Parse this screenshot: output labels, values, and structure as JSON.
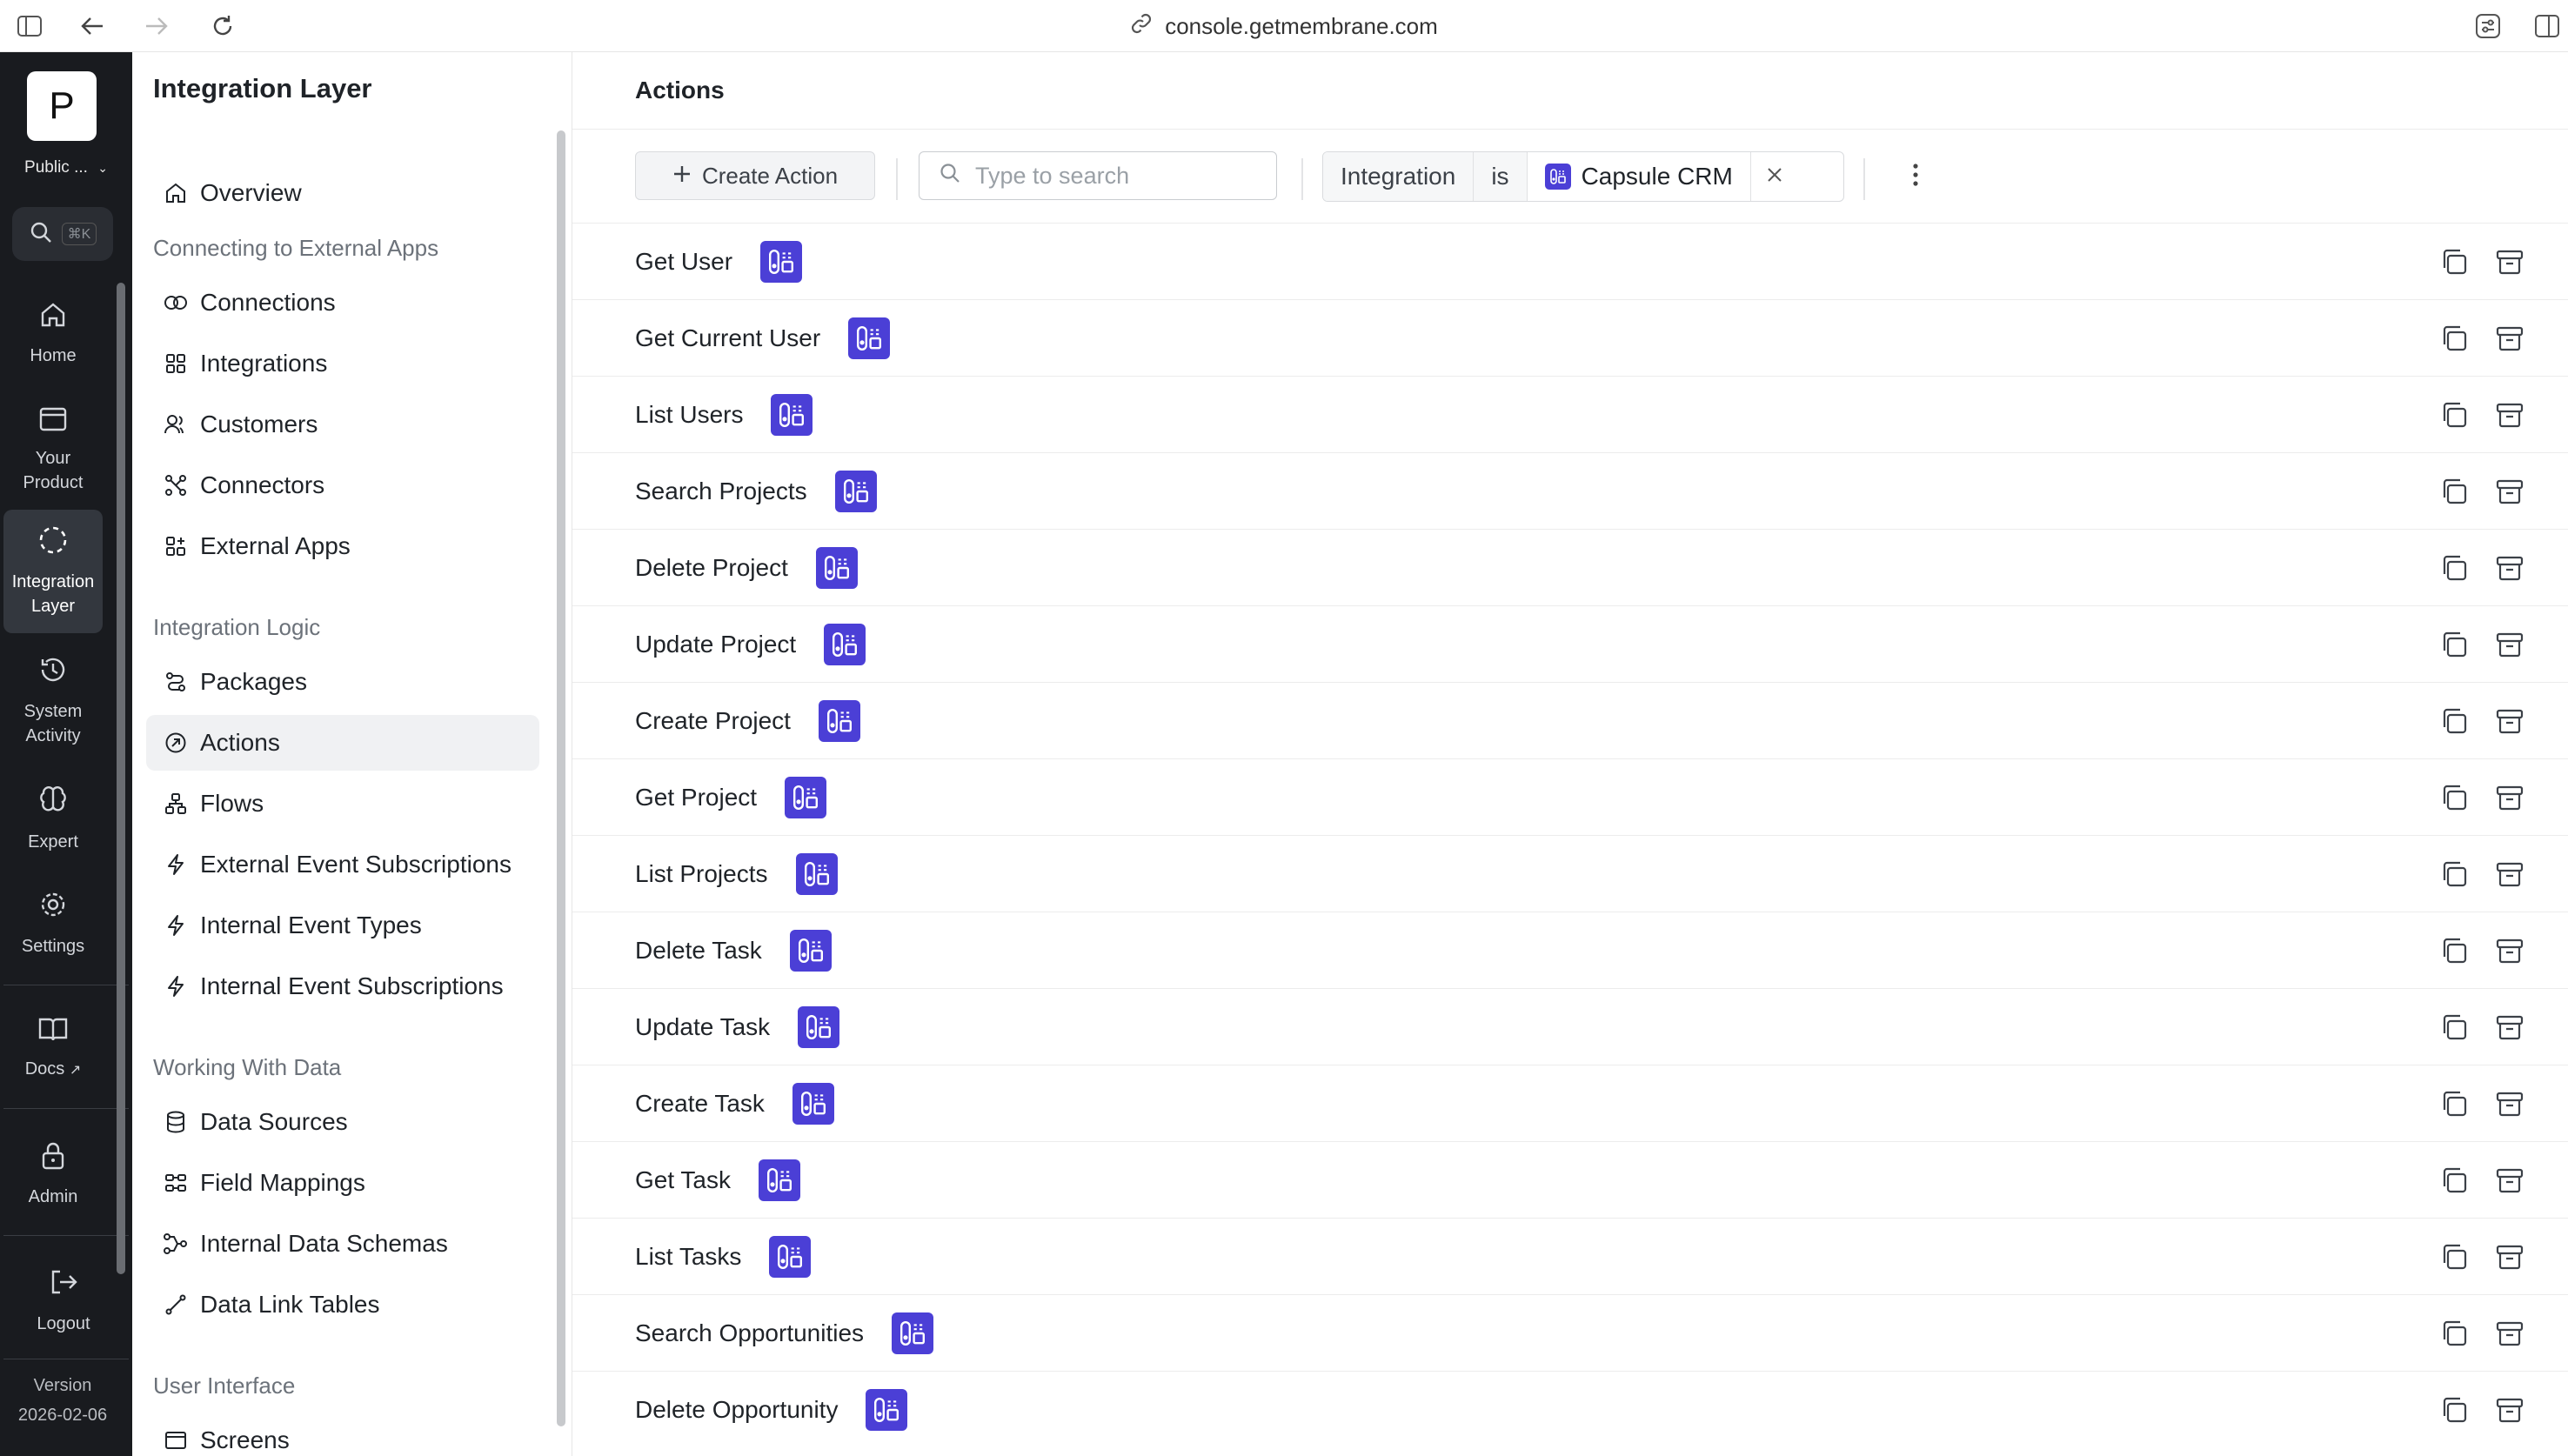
{
  "browser": {
    "url": "console.getmembrane.com"
  },
  "rail": {
    "logo_letter": "P",
    "org_label": "Public ...",
    "search_shortcut": "⌘K",
    "items": [
      {
        "label": "Home",
        "icon": "home-icon"
      },
      {
        "label": "Your Product",
        "icon": "browser-window-icon"
      },
      {
        "label": "Integration Layer",
        "icon": "dashed-circle-icon",
        "active": true
      },
      {
        "label": "System Activity",
        "icon": "history-icon"
      },
      {
        "label": "Expert",
        "icon": "brain-icon"
      },
      {
        "label": "Settings",
        "icon": "gear-icon"
      },
      {
        "label": "Docs",
        "icon": "book-icon"
      },
      {
        "label": "Admin",
        "icon": "lock-icon"
      },
      {
        "label": "Logout",
        "icon": "logout-icon"
      }
    ],
    "version_label": "Version",
    "version_value": "2026-02-06"
  },
  "sidebar": {
    "title": "Integration Layer",
    "overview": "Overview",
    "sections": [
      {
        "title": "Connecting to External Apps",
        "items": [
          "Connections",
          "Integrations",
          "Customers",
          "Connectors",
          "External Apps"
        ]
      },
      {
        "title": "Integration Logic",
        "items": [
          "Packages",
          "Actions",
          "Flows",
          "External Event Subscriptions",
          "Internal Event Types",
          "Internal Event Subscriptions"
        ]
      },
      {
        "title": "Working With Data",
        "items": [
          "Data Sources",
          "Field Mappings",
          "Internal Data Schemas",
          "Data Link Tables"
        ]
      },
      {
        "title": "User Interface",
        "items": [
          "Screens"
        ]
      }
    ],
    "active_item": "Actions"
  },
  "main": {
    "title": "Actions",
    "create_button": "Create Action",
    "search_placeholder": "Type to search",
    "filter": {
      "field": "Integration",
      "operator": "is",
      "value": "Capsule CRM"
    },
    "accent_color": "#4b3fd6",
    "rows": [
      "Get User",
      "Get Current User",
      "List Users",
      "Search Projects",
      "Delete Project",
      "Update Project",
      "Create Project",
      "Get Project",
      "List Projects",
      "Delete Task",
      "Update Task",
      "Create Task",
      "Get Task",
      "List Tasks",
      "Search Opportunities",
      "Delete Opportunity"
    ]
  }
}
